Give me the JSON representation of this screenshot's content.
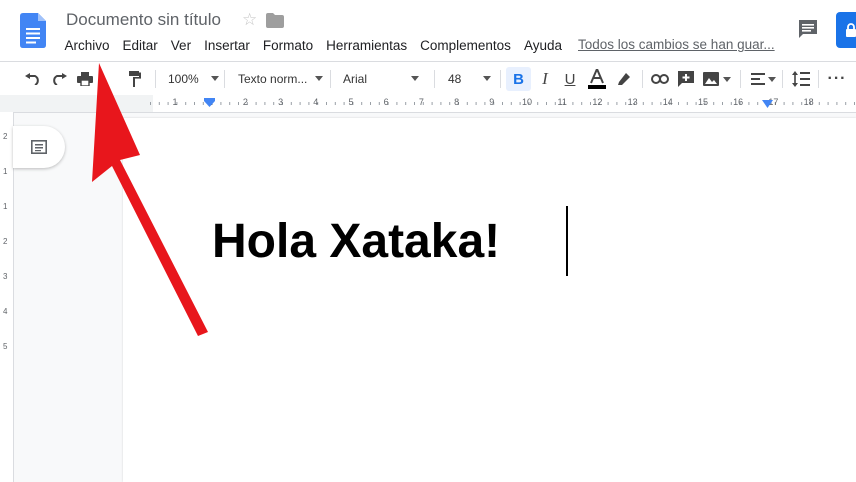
{
  "app": {
    "title": "Documento sin título",
    "saved_status": "Todos los cambios se han guar..."
  },
  "menu": {
    "items": [
      "Archivo",
      "Editar",
      "Ver",
      "Insertar",
      "Formato",
      "Herramientas",
      "Complementos",
      "Ayuda"
    ]
  },
  "toolbar": {
    "zoom": "100%",
    "style": "Texto norm...",
    "font": "Arial",
    "font_size": "48"
  },
  "ruler": {
    "marks": [
      "1",
      "1",
      "2",
      "3",
      "4",
      "5",
      "6",
      "7",
      "8",
      "9",
      "10",
      "11",
      "12",
      "13",
      "14",
      "15",
      "16",
      "17",
      "18"
    ]
  },
  "document": {
    "text": "Hola Xataka!"
  },
  "colors": {
    "accent": "#1a73e8",
    "annotation_arrow": "#e8161c",
    "text_color_underline": "#000000"
  },
  "icons": [
    "docs-icon",
    "star-icon",
    "folder-icon",
    "comments-icon",
    "share-button",
    "undo-icon",
    "redo-icon",
    "print-icon",
    "paint-format-icon",
    "bold-icon",
    "italic-icon",
    "underline-icon",
    "text-color-icon",
    "highlight-icon",
    "link-icon",
    "comment-add-icon",
    "image-icon",
    "align-icon",
    "line-spacing-icon",
    "more-icon",
    "outline-icon"
  ]
}
